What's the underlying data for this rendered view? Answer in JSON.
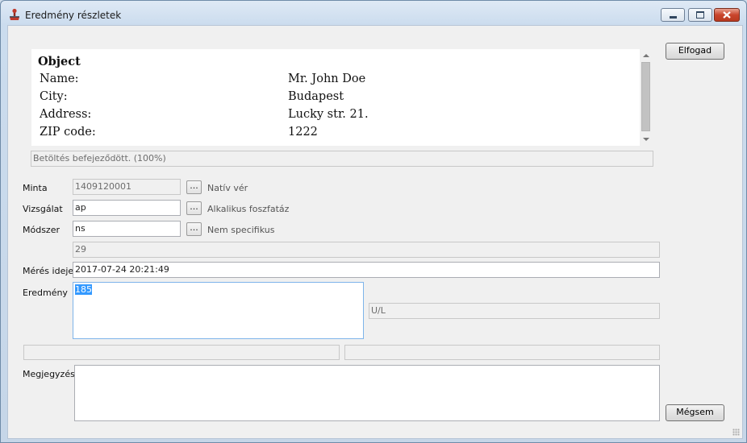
{
  "window": {
    "title": "Eredmény részletek",
    "icon": "person-stamp-icon",
    "controls": {
      "minimize": "minimize-icon",
      "maximize": "maximize-icon",
      "close": "close-icon"
    }
  },
  "info_panel": {
    "heading": "Object",
    "rows": [
      {
        "label": "Name:",
        "value": "Mr. John Doe"
      },
      {
        "label": "City:",
        "value": "Budapest"
      },
      {
        "label": "Address:",
        "value": "Lucky str. 21."
      },
      {
        "label": "ZIP code:",
        "value": "1222"
      }
    ]
  },
  "status": {
    "text": "Betöltés befejeződött. (100%)"
  },
  "form": {
    "sample": {
      "label": "Minta",
      "value": "1409120001",
      "description": "Natív vér"
    },
    "test": {
      "label": "Vizsgálat",
      "value": "ap",
      "description": "Alkalikus foszfatáz"
    },
    "method": {
      "label": "Módszer",
      "value": "ns",
      "description": "Nem specifikus"
    },
    "code": {
      "value": "29"
    },
    "measure_time": {
      "label": "Mérés ideje",
      "value": "2017-07-24 20:21:49"
    },
    "result": {
      "label": "Eredmény",
      "value": "185",
      "unit": "U/L"
    },
    "note": {
      "label": "Megjegyzés",
      "value": ""
    },
    "browse_label": "..."
  },
  "buttons": {
    "accept": "Elfogad",
    "cancel": "Mégsem"
  },
  "colors": {
    "selection": "#3399ff",
    "close_button": "#c9452c"
  }
}
